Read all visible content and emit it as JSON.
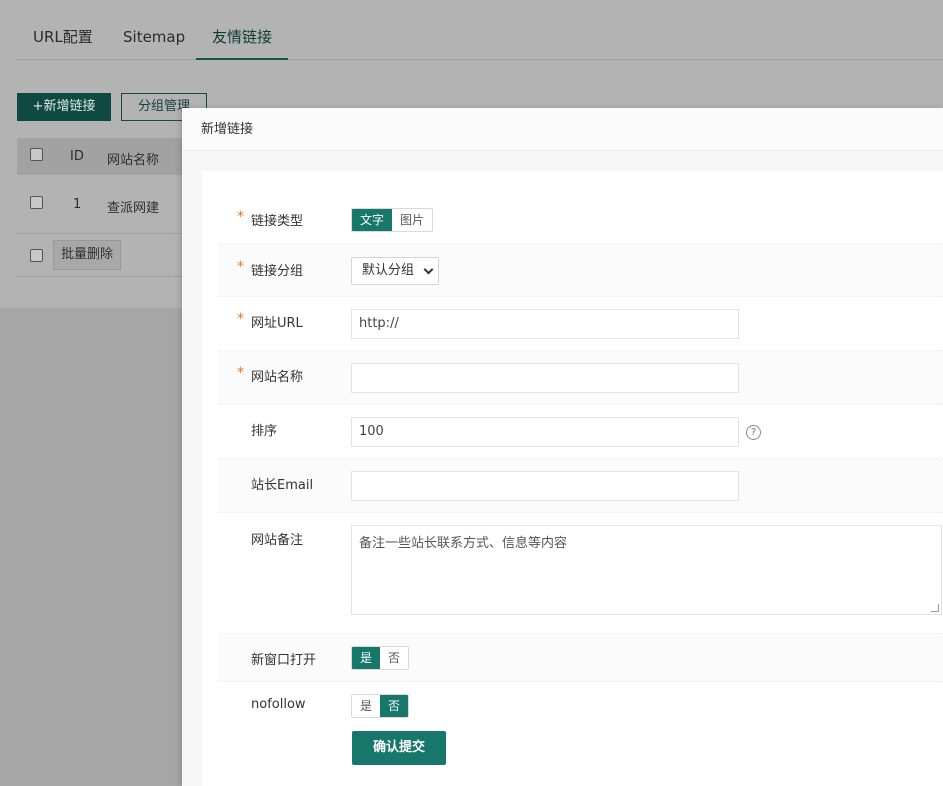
{
  "tabs": [
    "URL配置",
    "Sitemap",
    "友情链接"
  ],
  "active_tab": "友情链接",
  "toolbar": {
    "add_label": "+新增链接",
    "group_label": "分组管理"
  },
  "table": {
    "headers": [
      "ID",
      "网站名称"
    ],
    "rows": [
      {
        "id": "1",
        "name": "查派网建"
      }
    ],
    "batch_delete_label": "批量删除"
  },
  "modal": {
    "title": "新增链接",
    "link_type": {
      "label": "链接类型",
      "options": [
        "文字",
        "图片"
      ],
      "selected": "文字"
    },
    "link_group": {
      "label": "链接分组",
      "value": "默认分组"
    },
    "url": {
      "label": "网址URL",
      "value": "http://"
    },
    "site_name": {
      "label": "网站名称",
      "value": ""
    },
    "sort": {
      "label": "排序",
      "value": "100",
      "help": "?"
    },
    "email": {
      "label": "站长Email",
      "value": ""
    },
    "remark": {
      "label": "网站备注",
      "placeholder": "备注一些站长联系方式、信息等内容"
    },
    "new_window": {
      "label": "新窗口打开",
      "options": [
        "是",
        "否"
      ],
      "selected": "是"
    },
    "nofollow": {
      "label": "nofollow",
      "options": [
        "是",
        "否"
      ],
      "selected": "否"
    },
    "submit_label": "确认提交"
  },
  "colors": {
    "primary": "#16776a",
    "required": "#e8781b"
  }
}
